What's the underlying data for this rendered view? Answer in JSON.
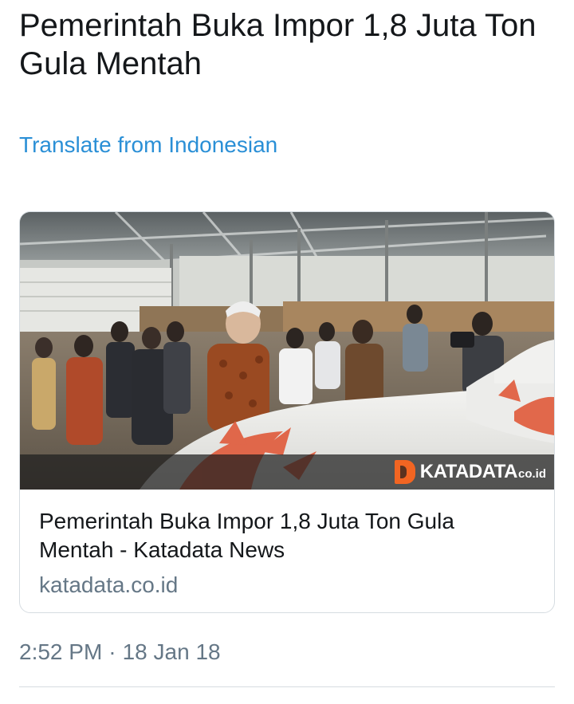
{
  "tweet": {
    "text": "Pemerintah Buka Impor 1,8 Juta Ton Gula Mentah",
    "translate_label": "Translate from Indonesian",
    "time": "2:52 PM",
    "separator": "·",
    "date": "18 Jan 18"
  },
  "card": {
    "title": "Pemerintah Buka Impor 1,8 Juta Ton Gula Mentah - Katadata News",
    "domain": "katadata.co.id",
    "image": {
      "watermark_name": "KATADATA",
      "watermark_suffix": "co.id",
      "brand_color": "#f26522"
    }
  },
  "colors": {
    "link": "#2a8fd6",
    "text": "#14171a",
    "muted": "#657786",
    "border": "#d6dce1"
  }
}
